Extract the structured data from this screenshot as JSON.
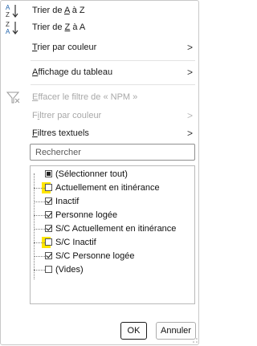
{
  "menu": {
    "sort_az": {
      "prefix": "Trier de ",
      "key": "A",
      "suffix": " à Z",
      "icon": "sort-ascending-icon"
    },
    "sort_za": {
      "prefix": "Trier de ",
      "key": "Z",
      "suffix": " à A",
      "icon": "sort-descending-icon"
    },
    "sort_color": {
      "key": "T",
      "rest": "rier par couleur",
      "arrow": ">"
    },
    "view": {
      "key": "A",
      "rest": "ffichage du tableau",
      "arrow": ">"
    },
    "clear_filter": {
      "key": "E",
      "rest": "ffacer le filtre de « NPM »",
      "icon": "clear-filter-icon"
    },
    "filter_color": {
      "pre": "F",
      "key": "i",
      "rest": "ltrer par couleur",
      "arrow": ">"
    },
    "text_filters": {
      "key": "F",
      "rest": "iltres textuels",
      "arrow": ">"
    }
  },
  "search": {
    "placeholder": "Rechercher"
  },
  "list": {
    "items": [
      {
        "label": "(Sélectionner tout)",
        "state": "partial",
        "highlight": false
      },
      {
        "label": "Actuellement en itinérance",
        "state": "unchecked",
        "highlight": true
      },
      {
        "label": "Inactif",
        "state": "checked",
        "highlight": false
      },
      {
        "label": "Personne logée",
        "state": "checked",
        "highlight": false
      },
      {
        "label": "S/C Actuellement en itinérance",
        "state": "checked",
        "highlight": false
      },
      {
        "label": "S/C Inactif",
        "state": "unchecked",
        "highlight": true
      },
      {
        "label": "S/C Personne logée",
        "state": "checked",
        "highlight": false
      },
      {
        "label": "(Vides)",
        "state": "unchecked",
        "highlight": false
      }
    ]
  },
  "buttons": {
    "ok": "OK",
    "cancel": "Annuler"
  },
  "colors": {
    "highlight": "#ffe600",
    "border": "#c8c8c8"
  }
}
